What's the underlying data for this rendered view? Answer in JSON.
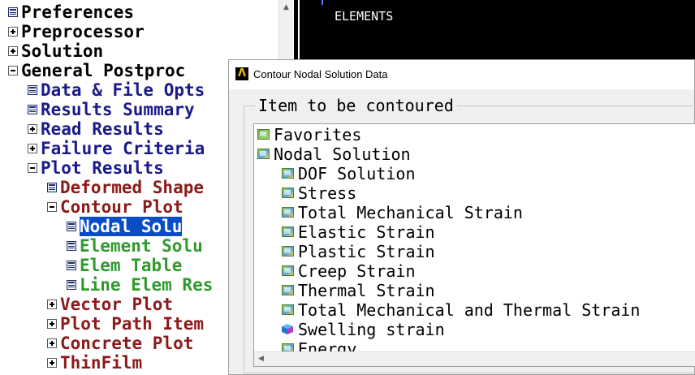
{
  "tree": {
    "items": [
      {
        "label": "Preferences"
      },
      {
        "label": "Preprocessor"
      },
      {
        "label": "Solution"
      },
      {
        "label": "General Postproc"
      },
      {
        "label": "Data & File Opts"
      },
      {
        "label": "Results Summary"
      },
      {
        "label": "Read Results"
      },
      {
        "label": "Failure Criteria"
      },
      {
        "label": "Plot Results"
      },
      {
        "label": "Deformed Shape"
      },
      {
        "label": "Contour Plot"
      },
      {
        "label": "Nodal Solu"
      },
      {
        "label": "Element Solu"
      },
      {
        "label": "Elem Table"
      },
      {
        "label": "Line Elem Res"
      },
      {
        "label": "Vector Plot"
      },
      {
        "label": "Plot Path Item"
      },
      {
        "label": "Concrete Plot"
      },
      {
        "label": "ThinFilm"
      }
    ],
    "scroll_up_glyph": "▲"
  },
  "graphics": {
    "label": "ELEMENTS",
    "background": "#000000"
  },
  "dialog": {
    "title": "Contour Nodal Solution Data",
    "app_icon_glyph": "Λ",
    "group_label": "Item to be contoured",
    "list": [
      {
        "label": "Favorites"
      },
      {
        "label": "Nodal Solution"
      },
      {
        "label": "DOF Solution"
      },
      {
        "label": "Stress"
      },
      {
        "label": "Total Mechanical Strain"
      },
      {
        "label": "Elastic Strain"
      },
      {
        "label": "Plastic Strain"
      },
      {
        "label": "Creep Strain"
      },
      {
        "label": "Thermal Strain"
      },
      {
        "label": "Total Mechanical and Thermal Strain"
      },
      {
        "label": "Swelling strain"
      },
      {
        "label": "Energy"
      }
    ],
    "scroll_left_glyph": "◀"
  },
  "colors": {
    "selection": "#0a4cc4",
    "navy": "#1a1a8c",
    "maroon": "#8b1a1a",
    "green": "#2e9a2e"
  }
}
